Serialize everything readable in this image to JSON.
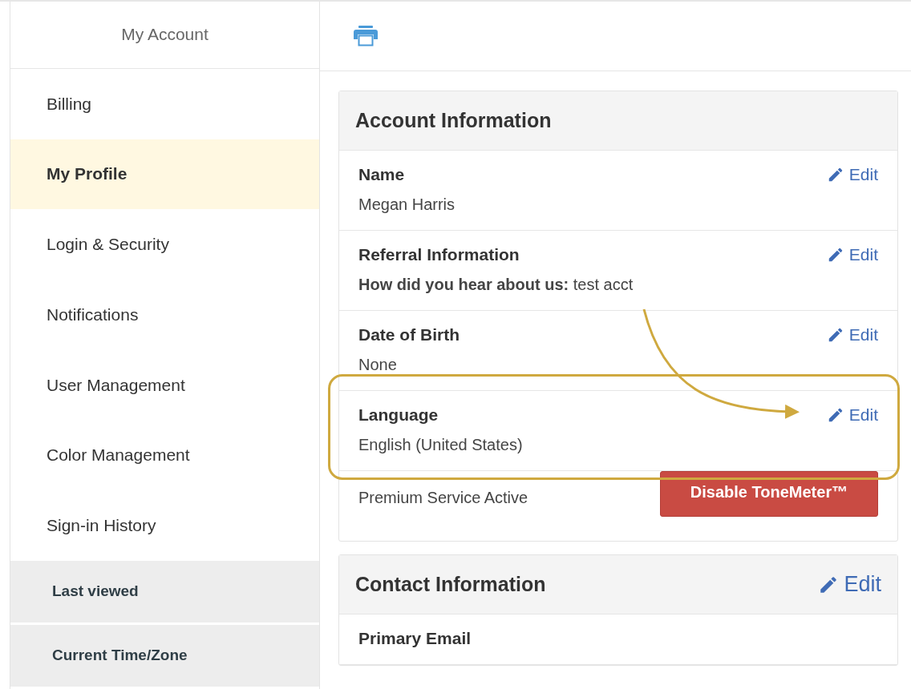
{
  "sidebar": {
    "title": "My Account",
    "items": [
      {
        "label": "Billing",
        "kind": "link",
        "selected": false
      },
      {
        "label": "My Profile",
        "kind": "link",
        "selected": true
      },
      {
        "label": "Login & Security",
        "kind": "link",
        "selected": false
      },
      {
        "label": "Notifications",
        "kind": "link",
        "selected": false
      },
      {
        "label": "User Management",
        "kind": "link",
        "selected": false
      },
      {
        "label": "Color Management",
        "kind": "link",
        "selected": false
      },
      {
        "label": "Sign-in History",
        "kind": "link",
        "selected": false
      },
      {
        "label": "Last viewed",
        "kind": "info"
      },
      {
        "label": "Current Time/Zone",
        "kind": "info"
      }
    ]
  },
  "panels": [
    {
      "title": "Account Information",
      "fields": [
        {
          "label": "Name",
          "value": "Megan Harris",
          "edit": "Edit",
          "highlighted": false
        },
        {
          "label": "Referral Information",
          "value": "**How did you hear about us:** test acct",
          "edit": "Edit",
          "highlighted": false
        },
        {
          "label": "Date of Birth",
          "value": "None",
          "edit": "Edit",
          "highlighted": false
        },
        {
          "label": "Language",
          "value": "English (United States)",
          "edit": "Edit",
          "highlighted": true
        }
      ],
      "footer": {
        "status": "Premium Service Active",
        "button": "Disable ToneMeter™"
      }
    },
    {
      "title": "Contact Information",
      "edit": "Edit",
      "fields": [
        {
          "label": "Primary Email",
          "highlighted": false
        }
      ]
    }
  ]
}
